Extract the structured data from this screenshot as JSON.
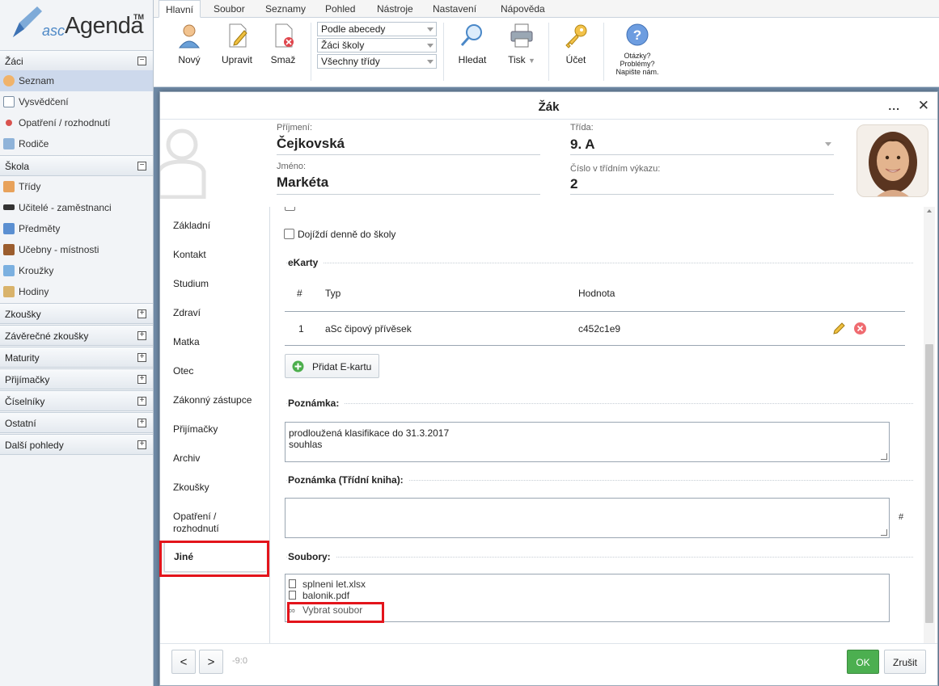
{
  "app": {
    "logo_prefix": "asc",
    "logo_name": "Agenda",
    "logo_tm": "TM"
  },
  "sidebar": {
    "sections": [
      {
        "label": "Žáci",
        "toggle": "−"
      },
      {
        "label": "Škola",
        "toggle": "−"
      },
      {
        "label": "Zkoušky",
        "toggle": "+"
      },
      {
        "label": "Závěrečné zkoušky",
        "toggle": "+"
      },
      {
        "label": "Maturity",
        "toggle": "+"
      },
      {
        "label": "Přijímačky",
        "toggle": "+"
      },
      {
        "label": "Číselníky",
        "toggle": "+"
      },
      {
        "label": "Ostatní",
        "toggle": "+"
      },
      {
        "label": "Další pohledy",
        "toggle": "+"
      }
    ],
    "zaci_items": [
      {
        "label": "Seznam",
        "icon": "user-icon"
      },
      {
        "label": "Vysvědčení",
        "icon": "certificate-icon"
      },
      {
        "label": "Opatření / rozhodnutí",
        "icon": "pin-icon"
      },
      {
        "label": "Rodiče",
        "icon": "parents-icon"
      }
    ],
    "skola_items": [
      {
        "label": "Třídy",
        "icon": "class-icon"
      },
      {
        "label": "Učitelé - zaměstnanci",
        "icon": "graduation-cap-icon"
      },
      {
        "label": "Předměty",
        "icon": "book-icon"
      },
      {
        "label": "Učebny - místnosti",
        "icon": "door-icon"
      },
      {
        "label": "Kroužky",
        "icon": "puzzle-icon"
      },
      {
        "label": "Hodiny",
        "icon": "people-icon"
      }
    ]
  },
  "ribbon": {
    "tabs": [
      "Hlavní",
      "Soubor",
      "Seznamy",
      "Pohled",
      "Nástroje",
      "Nastavení",
      "Nápověda"
    ],
    "buttons": {
      "new": "Nový",
      "edit": "Upravit",
      "delete": "Smaž",
      "search": "Hledat",
      "print": "Tisk",
      "account": "Účet"
    },
    "selects": [
      "Podle abecedy",
      "Žáci školy",
      "Všechny třídy"
    ],
    "help": {
      "line1": "Otázky?",
      "line2": "Problémy?",
      "line3": "Napište nám."
    }
  },
  "dialog": {
    "title": "Žák",
    "more": "...",
    "close": "✕",
    "header": {
      "surname_label": "Příjmení:",
      "surname": "Čejkovská",
      "name_label": "Jméno:",
      "name": "Markéta",
      "class_label": "Třída:",
      "class": "9. A",
      "number_label": "Číslo v třídním výkazu:",
      "number": "2"
    },
    "nav": [
      "Základní",
      "Kontakt",
      "Studium",
      "Zdraví",
      "Matka",
      "Otec",
      "Zákonný zástupce",
      "Přijímačky",
      "Archiv",
      "Zkoušky",
      "Opatření / rozhodnutí"
    ],
    "nav_active": "Jiné",
    "content": {
      "commute_label": "Dojíždí denně do školy",
      "ekarty_title": "eKarty",
      "ekarty_columns": [
        "#",
        "Typ",
        "Hodnota"
      ],
      "ekarty_rows": [
        {
          "num": "1",
          "type": "aSc čipový přívěsek",
          "value": "c452c1e9"
        }
      ],
      "add_card": "Přidat E-kartu",
      "note_title": "Poznámka:",
      "note_line1": "prodloužená klasifikace do 31.3.2017",
      "note_line2": "souhlas",
      "class_note_title": "Poznámka (Třídní kniha):",
      "class_note_hash": "#",
      "files_title": "Soubory:",
      "files": [
        "splneni let.xlsx",
        "balonik.pdf"
      ],
      "choose_file": "Vybrat soubor"
    },
    "footer": {
      "prev": "<",
      "next": ">",
      "counter": "-9:0",
      "ok": "OK",
      "cancel": "Zrušit"
    }
  },
  "colors": {
    "highlight": "#e3141b",
    "ok_green": "#4caf50",
    "accent": "#4d88c6"
  }
}
